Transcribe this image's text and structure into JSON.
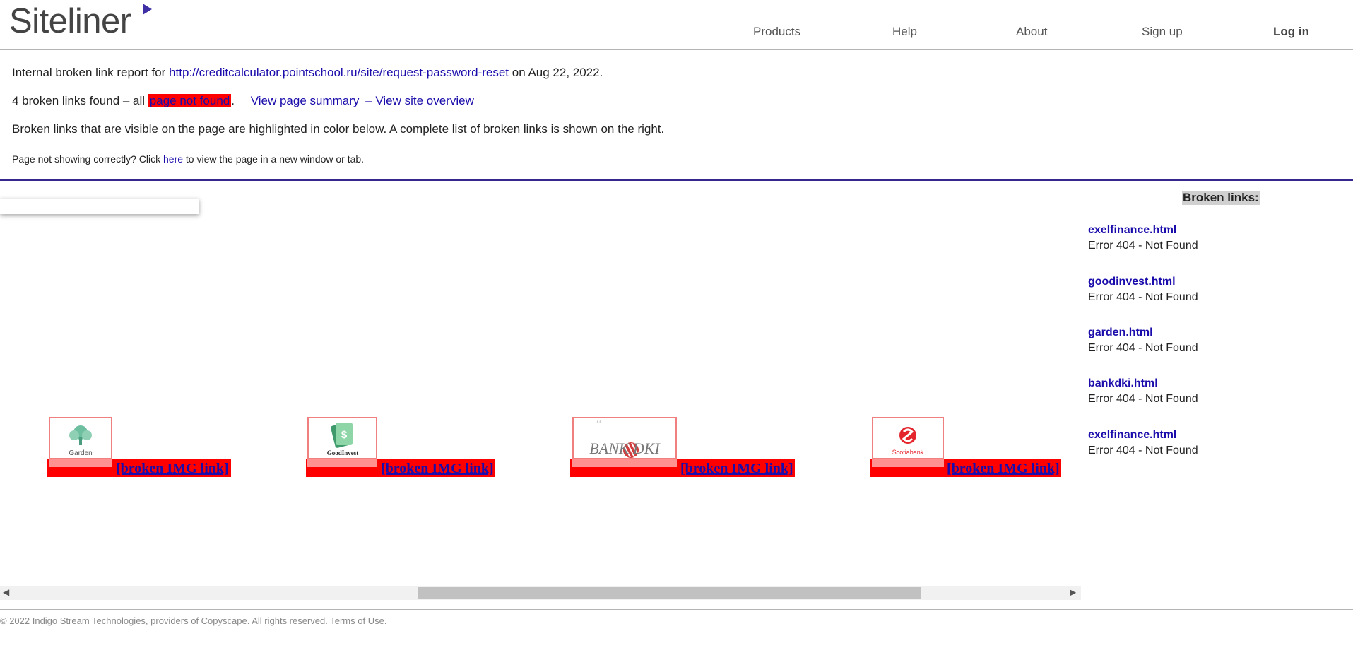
{
  "header": {
    "logo": "Siteliner",
    "nav": [
      "Products",
      "Help",
      "About",
      "Sign up",
      "Log in"
    ]
  },
  "report": {
    "intro_prefix": "Internal broken link report for ",
    "url": "http://creditcalculator.pointschool.ru/site/request-password-reset",
    "date_text": " on Aug 22, 2022.",
    "count_text": "4 broken links found – all ",
    "highlight_label": "page not found",
    "after_highlight": ".",
    "view_summary": "View page summary",
    "view_overview": "– View site overview",
    "visible_note": "Broken links that are visible on the page are highlighted in color below. A complete list of broken links is shown on the right.",
    "incorrect_prefix": "Page not showing correctly? Click ",
    "incorrect_link": "here",
    "incorrect_suffix": " to view the page in a new window or tab."
  },
  "preview": {
    "broken_label": "[broken IMG link]",
    "brands": [
      {
        "name": "Garden"
      },
      {
        "name": "GoodInvest"
      },
      {
        "name": "BANK DKI"
      },
      {
        "name": "Scotiabank"
      }
    ]
  },
  "sidebar": {
    "title": "Broken links:",
    "items": [
      {
        "link": "exelfinance.html",
        "error": "Error 404 - Not Found"
      },
      {
        "link": "goodinvest.html",
        "error": "Error 404 - Not Found"
      },
      {
        "link": "garden.html",
        "error": "Error 404 - Not Found"
      },
      {
        "link": "bankdki.html",
        "error": "Error 404 - Not Found"
      },
      {
        "link": "exelfinance.html",
        "error": "Error 404 - Not Found"
      }
    ]
  },
  "footer": {
    "text": "© 2022 Indigo Stream Technologies, providers of Copyscape. All rights reserved. Terms of Use."
  },
  "colors": {
    "accent": "#35278c",
    "highlight": "#ff0000",
    "link": "#1a0dab"
  }
}
